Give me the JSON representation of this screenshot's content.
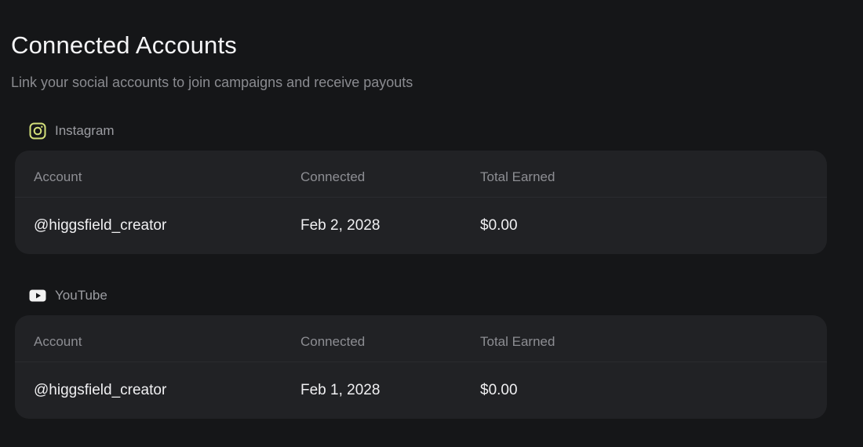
{
  "page": {
    "title": "Connected Accounts",
    "subtitle": "Link your social accounts to join campaigns and receive payouts"
  },
  "columns": {
    "account": "Account",
    "connected": "Connected",
    "earned": "Total Earned"
  },
  "sections": [
    {
      "platform": "Instagram",
      "icon": "instagram-icon",
      "icon_color": "#d4e07a",
      "rows": [
        {
          "account": "@higgsfield_creator",
          "connected": "Feb 2, 2028",
          "earned": "$0.00"
        }
      ]
    },
    {
      "platform": "YouTube",
      "icon": "youtube-icon",
      "icon_color": "#f2f2f2",
      "rows": [
        {
          "account": "@higgsfield_creator",
          "connected": "Feb 1, 2028",
          "earned": "$0.00"
        }
      ]
    }
  ],
  "colors": {
    "background": "#151618",
    "card": "#212225",
    "text_primary": "#f0f0f2",
    "text_muted": "#8d8e93"
  }
}
